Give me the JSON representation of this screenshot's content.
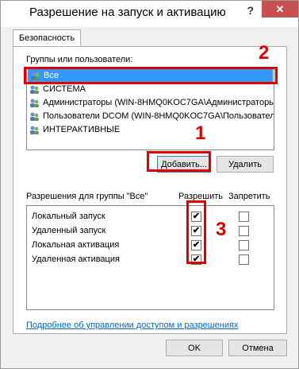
{
  "window": {
    "title": "Разрешение на запуск и активацию",
    "help": "?",
    "close": "✕"
  },
  "tab": {
    "label": "Безопасность"
  },
  "groups": {
    "label": "Группы или пользователи:",
    "items": [
      {
        "label": "Все"
      },
      {
        "label": "СИСТЕМА"
      },
      {
        "label": "Администраторы (WIN-8HMQ0KOC7GA\\Администраторы)"
      },
      {
        "label": "Пользователи DCOM (WIN-8HMQ0KOC7GA\\Пользователи DCOM)"
      },
      {
        "label": "ИНТЕРАКТИВНЫЕ"
      }
    ],
    "add_button": "Добавить...",
    "remove_button": "Удалить"
  },
  "permissions": {
    "label": "Разрешения для группы \"Все\"",
    "allow_header": "Разрешить",
    "deny_header": "Запретить",
    "rows": [
      {
        "label": "Локальный запуск",
        "allow": true,
        "deny": false
      },
      {
        "label": "Удаленный запуск",
        "allow": true,
        "deny": false
      },
      {
        "label": "Локальная активация",
        "allow": true,
        "deny": false
      },
      {
        "label": "Удаленная активация",
        "allow": true,
        "deny": false
      }
    ],
    "checkmark": "✔"
  },
  "link": "Подробнее об управлении доступом и разрешениях",
  "footer": {
    "ok": "OK",
    "cancel": "Отмена"
  },
  "annotations": {
    "one": "1",
    "two": "2",
    "three": "3"
  },
  "colors": {
    "highlight": "#e00000",
    "selection": "#3399ff"
  }
}
